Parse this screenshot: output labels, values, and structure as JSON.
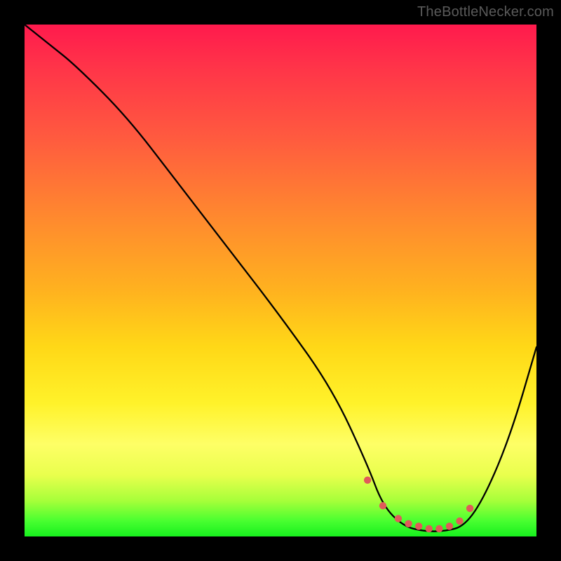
{
  "watermark": "TheBottleNecker.com",
  "chart_data": {
    "type": "line",
    "title": "",
    "xlabel": "",
    "ylabel": "",
    "xlim": [
      0,
      100
    ],
    "ylim": [
      0,
      100
    ],
    "series": [
      {
        "name": "bottleneck-curve",
        "x": [
          0,
          5,
          10,
          20,
          30,
          40,
          50,
          60,
          67,
          70,
          74,
          78,
          82,
          86,
          90,
          95,
          100
        ],
        "values": [
          100,
          96,
          92,
          82,
          69,
          56,
          43,
          29,
          14,
          6,
          2,
          1,
          1,
          2,
          8,
          20,
          37
        ]
      }
    ],
    "markers": {
      "name": "optimal-range-dots",
      "color": "#e05a5a",
      "x": [
        67,
        70,
        73,
        75,
        77,
        79,
        81,
        83,
        85,
        87
      ],
      "values": [
        11,
        6,
        3.5,
        2.5,
        2,
        1.5,
        1.5,
        2,
        3,
        5.5
      ]
    },
    "gradient_stops": [
      {
        "pos": 0,
        "color": "#ff1a4d"
      },
      {
        "pos": 50,
        "color": "#ffb21f"
      },
      {
        "pos": 80,
        "color": "#feff66"
      },
      {
        "pos": 100,
        "color": "#17f01e"
      }
    ]
  }
}
